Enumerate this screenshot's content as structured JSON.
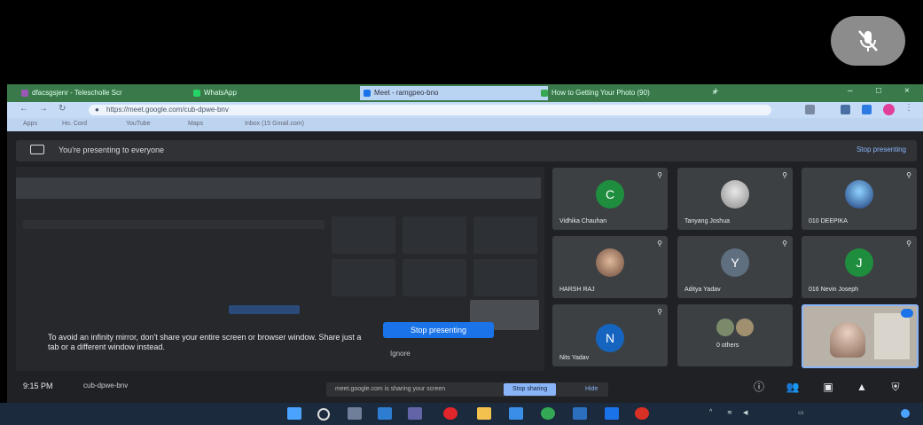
{
  "browser": {
    "tabs": [
      {
        "label": "dfacsgsjenr - Telescholle Scr",
        "color": "#9b59b6",
        "active": false
      },
      {
        "label": "WhatsApp",
        "color": "#25d366",
        "active": false
      },
      {
        "label": "Meet - ramgpeo-bno",
        "color": "#1a73e8",
        "active": true
      },
      {
        "label": "How to Getting Your Photo (90)",
        "color": "#34a853",
        "active": false
      }
    ],
    "url": "https://meet.google.com/cub-dpwe-bnv",
    "bookmarks": [
      "Apps",
      "Ho. Cord",
      "YouTube",
      "Maps",
      "Inbox (15 Gmail.com)"
    ]
  },
  "meet": {
    "presenting_text": "You're presenting to everyone",
    "stop_presenting_link": "Stop presenting",
    "warning_text": "To avoid an infinity mirror, don't share your entire screen or browser window. Share just a tab or a different window instead.",
    "stop_presenting_button": "Stop presenting",
    "ignore_label": "Ignore",
    "participants": [
      {
        "name": "Vidhika Chauhan",
        "initial": "C",
        "avatar_color": "#1e8e3e",
        "photo": false
      },
      {
        "name": "Tanyang Joshua",
        "initial": "",
        "avatar_color": "#c9c9c9",
        "photo": true
      },
      {
        "name": "010 DEEPIKA",
        "initial": "",
        "avatar_color": "#2b5fb3",
        "photo": true
      },
      {
        "name": "HARSH RAJ",
        "initial": "",
        "avatar_color": "#9c6b4a",
        "photo": true
      },
      {
        "name": "Aditya Yadav",
        "initial": "Y",
        "avatar_color": "#5f6f7f",
        "photo": false
      },
      {
        "name": "016 Nevin Joseph",
        "initial": "J",
        "avatar_color": "#1e8e3e",
        "photo": false
      },
      {
        "name": "Nits Yadav",
        "initial": "N",
        "avatar_color": "#1565c0",
        "photo": false
      },
      {
        "name": "0 others",
        "initial": "",
        "avatar_color": "#5a5a5a",
        "photo": true
      }
    ],
    "time": "9:15 PM",
    "meeting_code": "cub-dpwe-bnv",
    "share_notice": "meet.google.com is sharing your screen",
    "stop_sharing_label": "Stop sharing",
    "hide_label": "Hide"
  }
}
